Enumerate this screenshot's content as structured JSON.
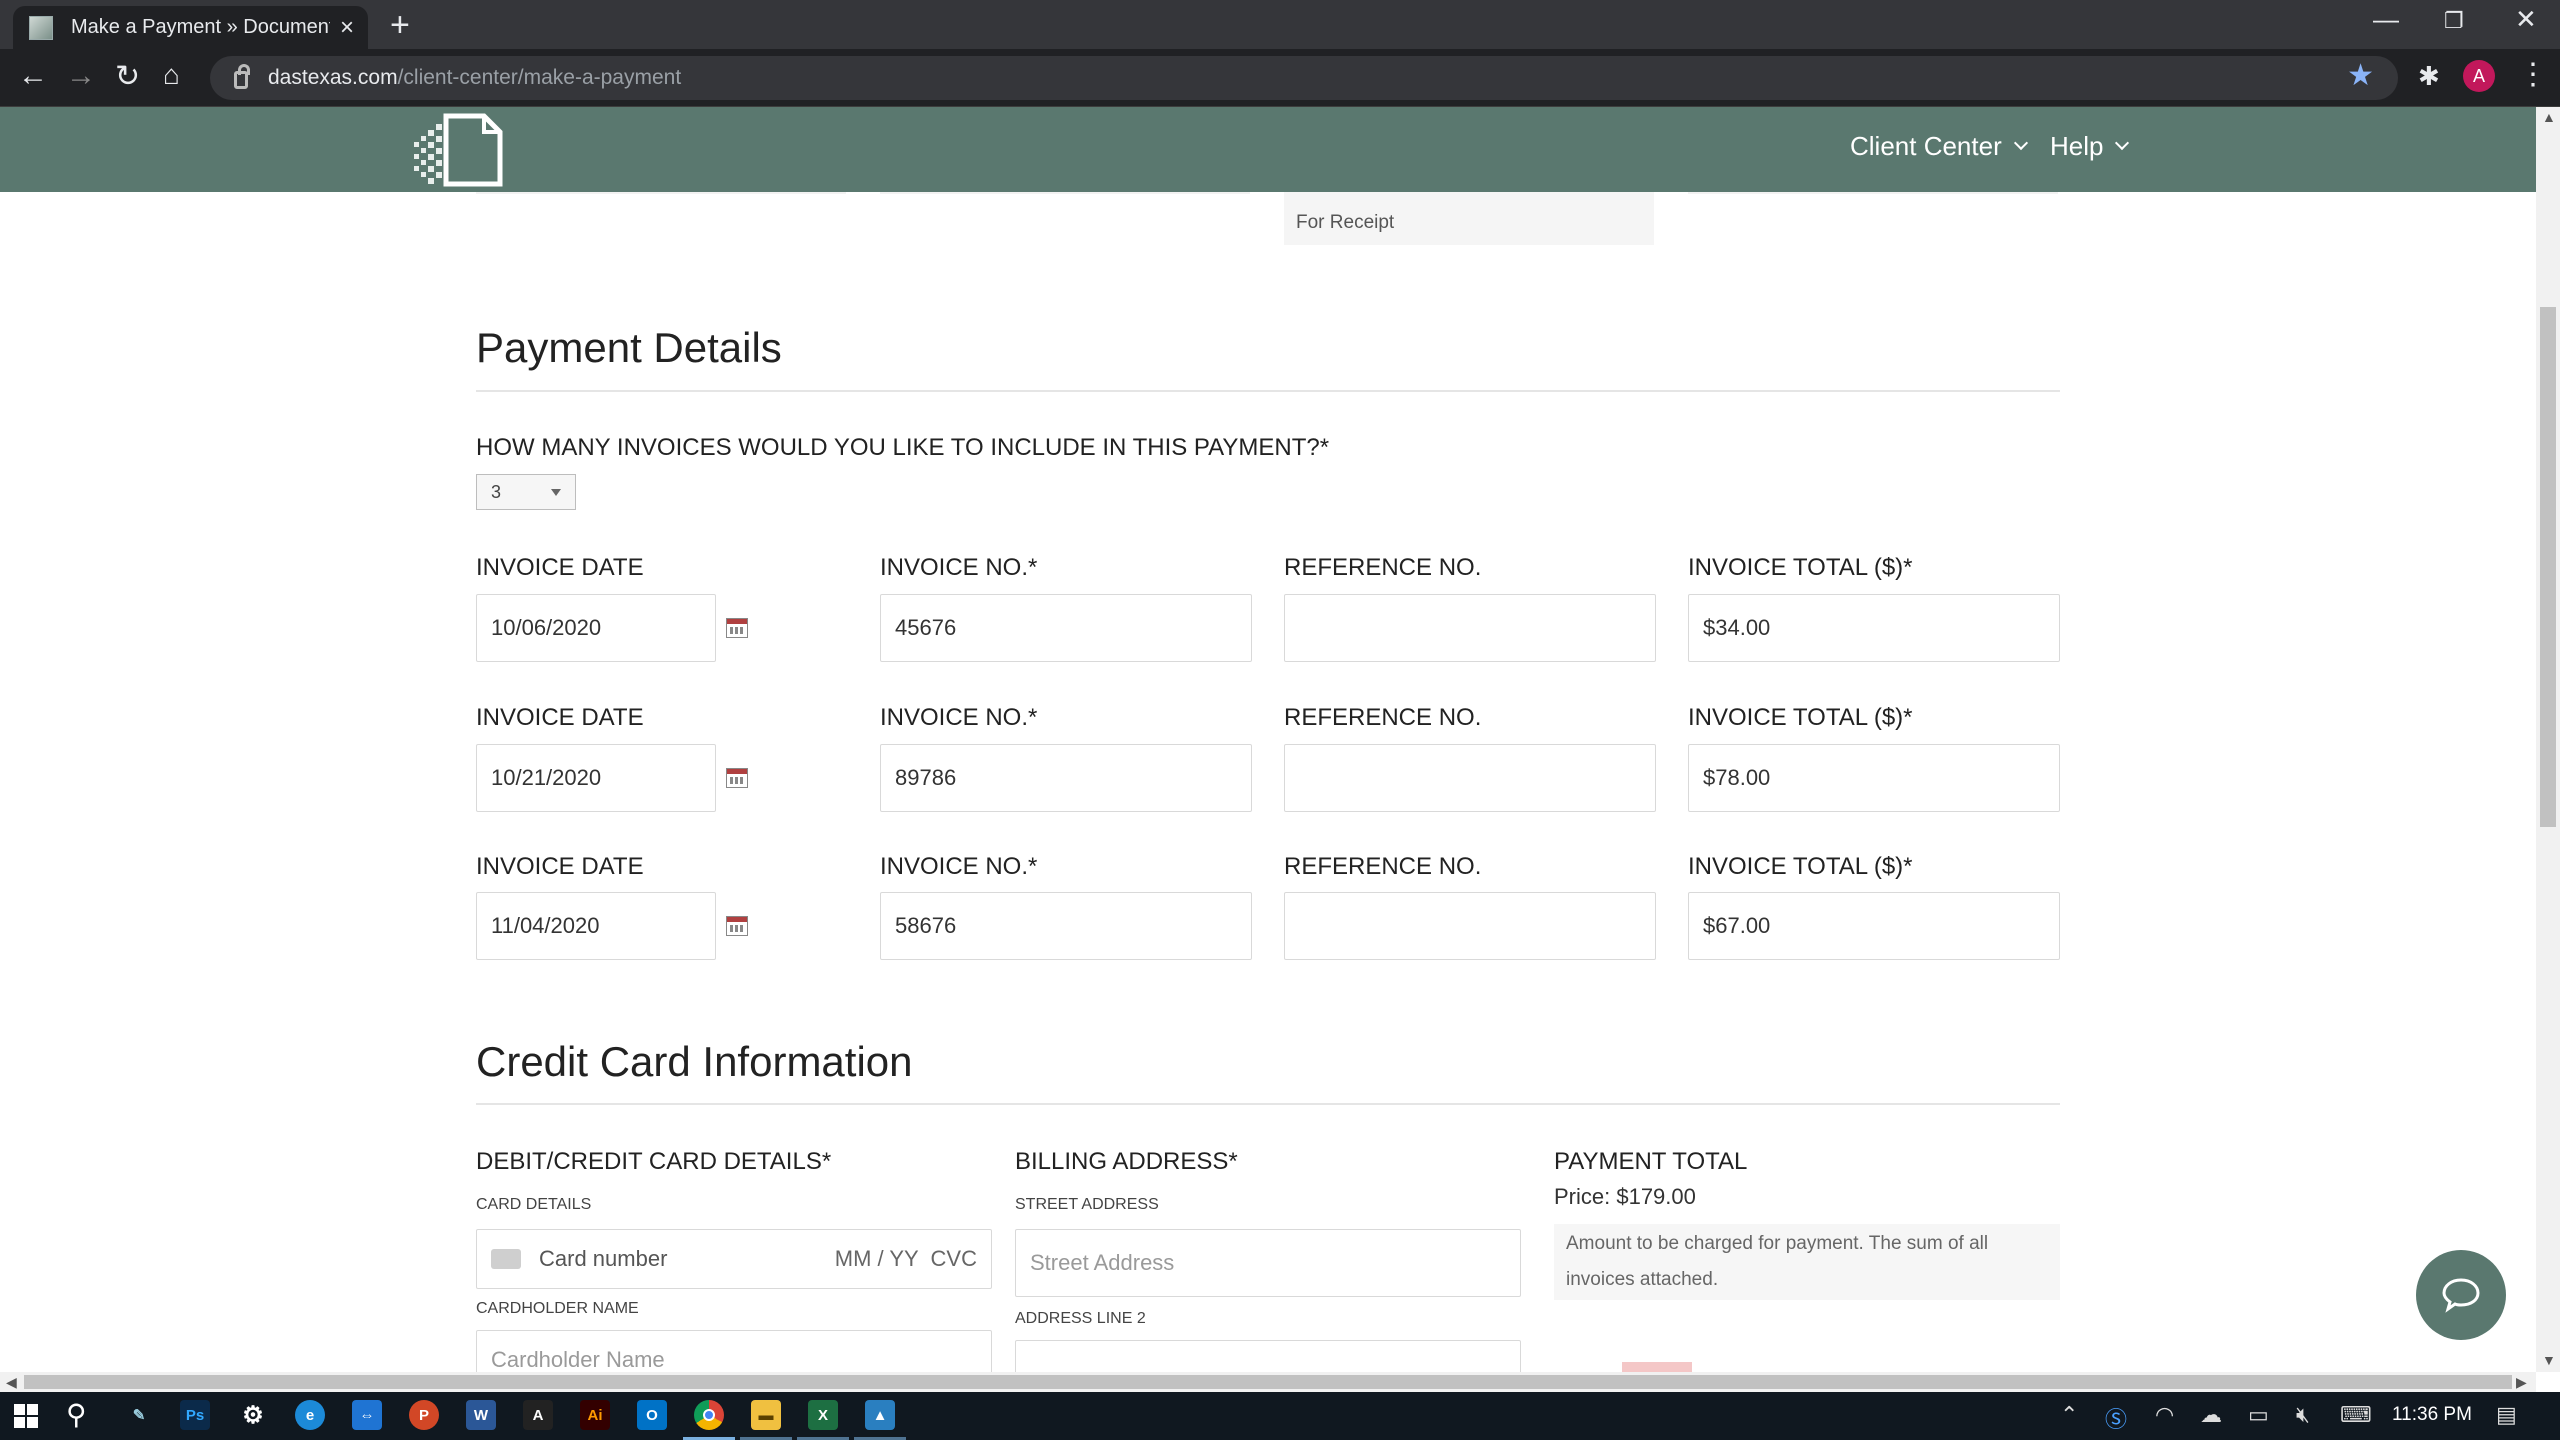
{
  "browser": {
    "tab_title": "Make a Payment » Document Ac",
    "url_host": "dastexas.com",
    "url_path": "/client-center/make-a-payment",
    "profile_initial": "A"
  },
  "nav": {
    "client_center": "Client Center",
    "help": "Help"
  },
  "receipt_label": "For Receipt",
  "payment_details": {
    "title": "Payment Details",
    "invoice_count_question": "HOW MANY INVOICES WOULD YOU LIKE TO INCLUDE IN THIS PAYMENT?*",
    "invoice_count_value": "3",
    "labels": {
      "date": "INVOICE DATE",
      "number": "INVOICE NO.*",
      "reference": "REFERENCE NO.",
      "total": "INVOICE TOTAL ($)*"
    },
    "invoices": [
      {
        "date": "10/06/2020",
        "number": "45676",
        "reference": "",
        "total": "$34.00"
      },
      {
        "date": "10/21/2020",
        "number": "89786",
        "reference": "",
        "total": "$78.00"
      },
      {
        "date": "11/04/2020",
        "number": "58676",
        "reference": "",
        "total": "$67.00"
      }
    ]
  },
  "credit_card": {
    "title": "Credit Card Information",
    "card_section_label": "DEBIT/CREDIT CARD DETAILS*",
    "card_details_label": "CARD DETAILS",
    "card_number_placeholder": "Card number",
    "card_expiry_cvc_placeholder": "MM / YY  CVC",
    "cardholder_label": "CARDHOLDER NAME",
    "cardholder_placeholder": "Cardholder Name",
    "billing_label": "BILLING ADDRESS*",
    "street_label": "STREET ADDRESS",
    "street_placeholder": "Street Address",
    "address2_label": "ADDRESS LINE 2",
    "payment_total_label": "PAYMENT TOTAL",
    "price": "Price: $179.00",
    "price_note": "Amount to be charged for payment. The sum of all invoices attached."
  },
  "taskbar": {
    "time": "11:36 PM"
  }
}
